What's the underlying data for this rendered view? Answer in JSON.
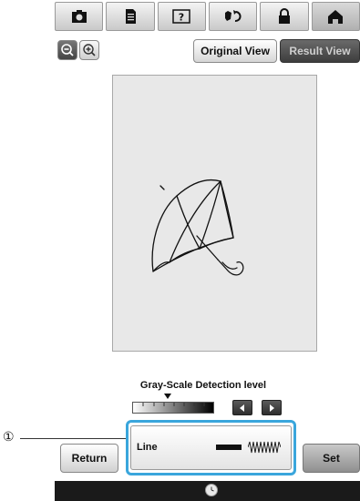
{
  "toolbar": {
    "icons": [
      "camera-icon",
      "document-icon",
      "help-icon",
      "embroidery-convert-icon",
      "lock-icon",
      "home-icon"
    ]
  },
  "zoom": {
    "icons": [
      "zoom-out-icon",
      "zoom-in-icon"
    ]
  },
  "view": {
    "original_label": "Original View",
    "result_label": "Result View"
  },
  "preview": {
    "image": "umbrella-line-drawing"
  },
  "grayscale": {
    "label": "Gray-Scale Detection level",
    "level": 0.43
  },
  "callout": {
    "number": "①"
  },
  "line_setting": {
    "label": "Line"
  },
  "buttons": {
    "return_label": "Return",
    "set_label": "Set"
  },
  "status": {
    "icon": "clock-icon"
  },
  "colors": {
    "highlight": "#3aa6dc",
    "bar": "#1a1a1a"
  }
}
